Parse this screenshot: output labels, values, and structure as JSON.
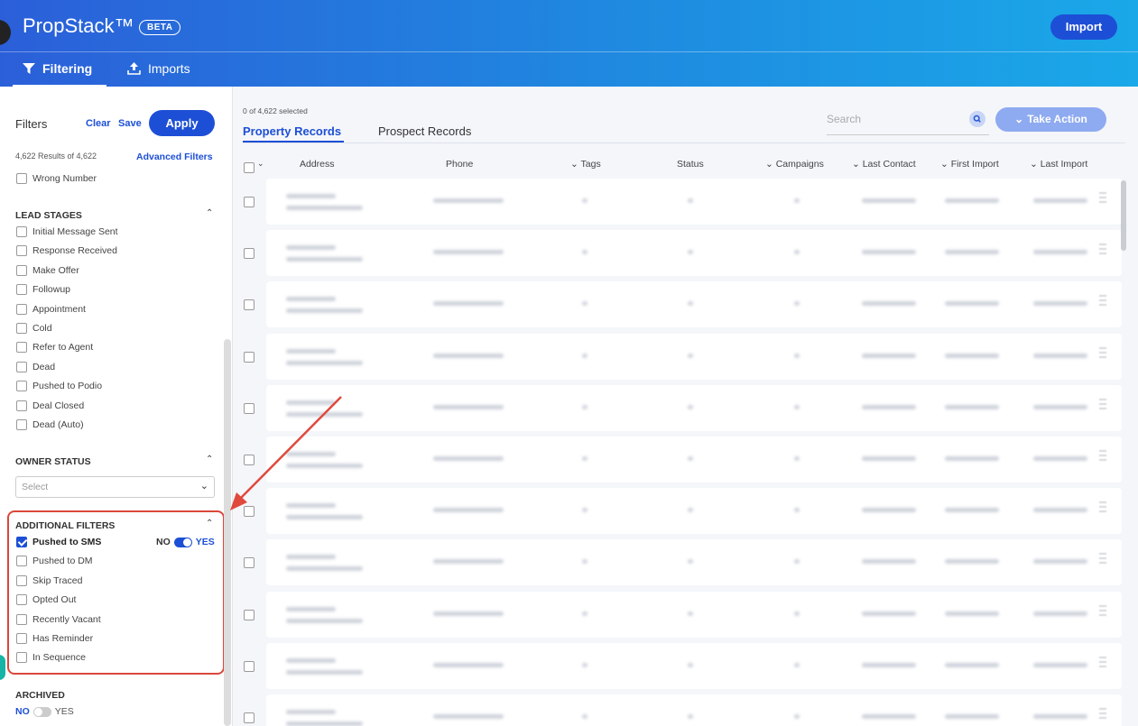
{
  "header": {
    "brand": "PropStack™",
    "badge": "BETA",
    "import_label": "Import",
    "nav": [
      {
        "label": "Filtering",
        "icon": "funnel-icon",
        "active": true
      },
      {
        "label": "Imports",
        "icon": "upload-icon",
        "active": false
      }
    ]
  },
  "sidebar": {
    "title": "Filters",
    "clear_label": "Clear",
    "save_label": "Save",
    "apply_label": "Apply",
    "results": "4,622 Results of 4,622",
    "advanced_label": "Advanced Filters",
    "wrong_number": "Wrong Number",
    "lead_stages": {
      "title": "LEAD STAGES",
      "items": [
        "Initial Message Sent",
        "Response Received",
        "Make Offer",
        "Followup",
        "Appointment",
        "Cold",
        "Refer to Agent",
        "Dead",
        "Pushed to Podio",
        "Deal Closed",
        "Dead (Auto)"
      ]
    },
    "owner_status": {
      "title": "OWNER STATUS",
      "placeholder": "Select"
    },
    "additional_filters": {
      "title": "ADDITIONAL FILTERS",
      "items": [
        {
          "label": "Pushed to SMS",
          "checked": true
        },
        {
          "label": "Pushed to DM",
          "checked": false
        },
        {
          "label": "Skip Traced",
          "checked": false
        },
        {
          "label": "Opted Out",
          "checked": false
        },
        {
          "label": "Recently Vacant",
          "checked": false
        },
        {
          "label": "Has Reminder",
          "checked": false
        },
        {
          "label": "In Sequence",
          "checked": false
        }
      ],
      "toggle_no": "NO",
      "toggle_yes": "YES",
      "toggle_on": true
    },
    "archived": {
      "title": "ARCHIVED",
      "toggle_no": "NO",
      "toggle_yes": "YES",
      "toggle_on": false
    }
  },
  "main": {
    "selected_count": "0 of 4,622 selected",
    "tabs": [
      "Property Records",
      "Prospect Records"
    ],
    "search_placeholder": "Search",
    "take_action_label": "Take Action",
    "columns": [
      "Address",
      "Phone",
      "Tags",
      "Status",
      "Campaigns",
      "Last Contact",
      "First Import",
      "Last Import"
    ]
  },
  "colors": {
    "accent": "#1d4fd6",
    "highlight": "#d9473b"
  }
}
